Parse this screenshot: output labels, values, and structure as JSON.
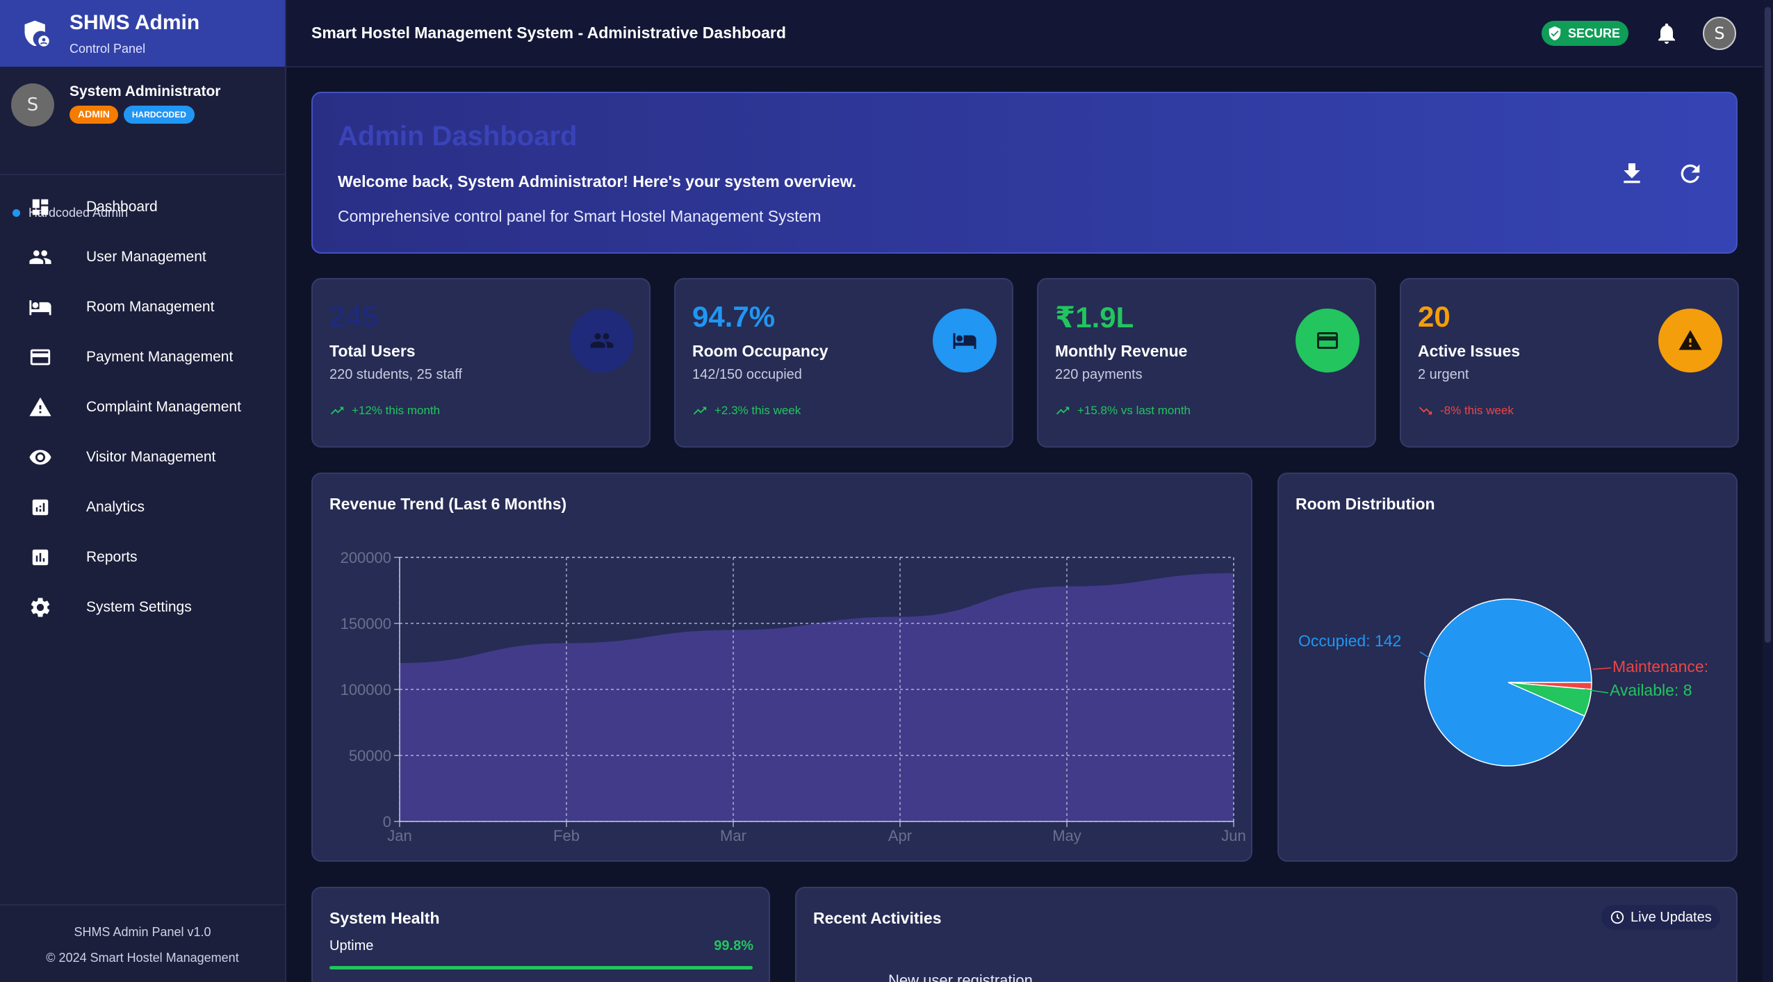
{
  "brand": {
    "title": "SHMS Admin",
    "subtitle": "Control Panel"
  },
  "user": {
    "name": "System Administrator",
    "initial": "S",
    "badge_role": "ADMIN",
    "badge_type": "HARDCODED",
    "status": "Hardcoded Admin"
  },
  "nav": [
    {
      "label": "Dashboard",
      "icon": "dashboard-icon"
    },
    {
      "label": "User Management",
      "icon": "people-icon"
    },
    {
      "label": "Room Management",
      "icon": "bed-icon"
    },
    {
      "label": "Payment Management",
      "icon": "credit-card-icon"
    },
    {
      "label": "Complaint Management",
      "icon": "warning-icon"
    },
    {
      "label": "Visitor Management",
      "icon": "eye-icon"
    },
    {
      "label": "Analytics",
      "icon": "analytics-icon"
    },
    {
      "label": "Reports",
      "icon": "bar-chart-icon"
    },
    {
      "label": "System Settings",
      "icon": "gear-icon"
    }
  ],
  "footer": {
    "version": "SHMS Admin Panel v1.0",
    "copyright": "© 2024 Smart Hostel Management"
  },
  "topbar": {
    "title": "Smart Hostel Management System - Administrative Dashboard",
    "secure_label": "SECURE",
    "avatar_initial": "S"
  },
  "hero": {
    "title": "Admin Dashboard",
    "welcome": "Welcome back, System Administrator! Here's your system overview.",
    "description": "Comprehensive control panel for Smart Hostel Management System"
  },
  "stats": [
    {
      "value": "245",
      "label": "Total Users",
      "sub": "220 students, 25 staff",
      "trend": "+12% this month",
      "trend_dir": "up",
      "color": "#1f2a7a",
      "icon": "people-icon"
    },
    {
      "value": "94.7%",
      "label": "Room Occupancy",
      "sub": "142/150 occupied",
      "trend": "+2.3% this week",
      "trend_dir": "up",
      "color": "#2196f3",
      "icon": "bed-icon"
    },
    {
      "value": "₹1.9L",
      "label": "Monthly Revenue",
      "sub": "220 payments",
      "trend": "+15.8% vs last month",
      "trend_dir": "up",
      "color": "#22c55e",
      "icon": "credit-card-icon"
    },
    {
      "value": "20",
      "label": "Active Issues",
      "sub": "2 urgent",
      "trend": "-8% this week",
      "trend_dir": "down",
      "color": "#f59e0b",
      "icon": "warning-icon"
    }
  ],
  "revenue_chart_title": "Revenue Trend (Last 6 Months)",
  "room_chart_title": "Room Distribution",
  "chart_data": [
    {
      "type": "area",
      "title": "Revenue Trend (Last 6 Months)",
      "x": [
        "Jan",
        "Feb",
        "Mar",
        "Apr",
        "May",
        "Jun"
      ],
      "y_ticks": [
        "0",
        "50000",
        "100000",
        "150000",
        "200000"
      ],
      "ylim": [
        0,
        200000
      ],
      "series": [
        {
          "values": [
            120000,
            135000,
            145000,
            155000,
            178000,
            188000
          ]
        }
      ],
      "grid": true,
      "color": "#413b8a"
    },
    {
      "type": "pie",
      "title": "Room Distribution",
      "slices": [
        {
          "label": "Occupied: 142",
          "value": 142,
          "color": "#2196f3"
        },
        {
          "label": "Available: 8",
          "value": 8,
          "color": "#22c55e"
        },
        {
          "label": "Maintenance:",
          "value": 2,
          "color": "#ef4444"
        }
      ]
    }
  ],
  "health": {
    "title": "System Health",
    "uptime_label": "Uptime",
    "uptime_value": "99.8%",
    "uptime_fraction": 0.998
  },
  "activities": {
    "title": "Recent Activities",
    "live_label": "Live Updates",
    "first_item": "New user registration"
  }
}
